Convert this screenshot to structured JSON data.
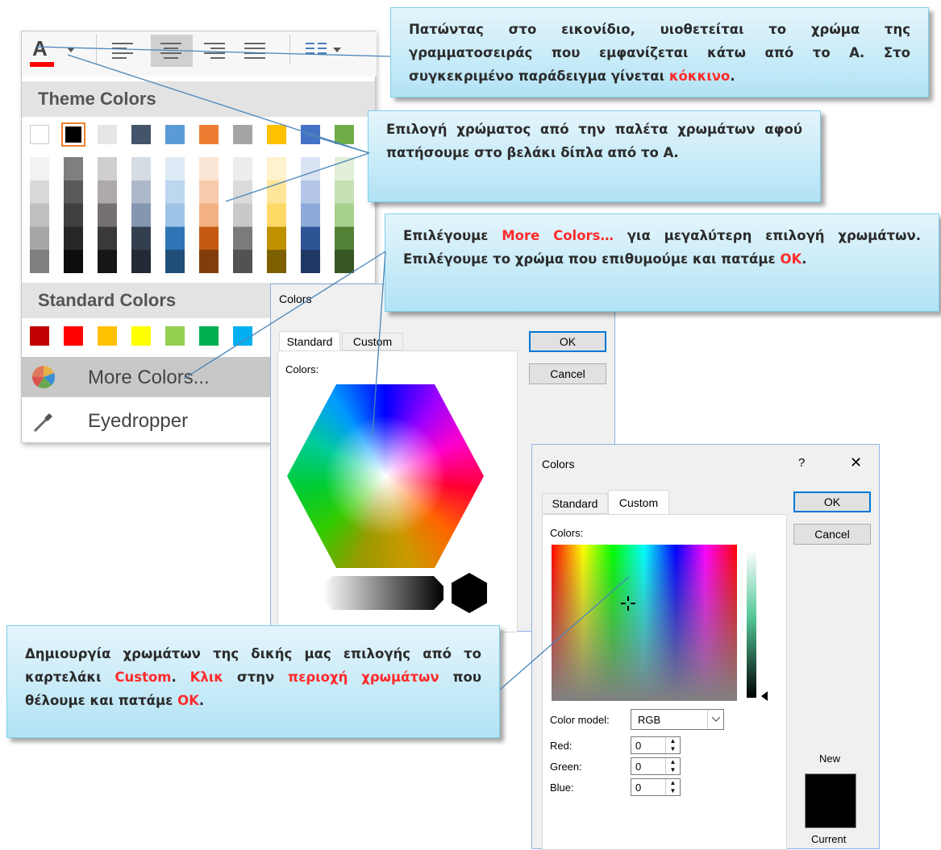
{
  "font_color_menu": {
    "theme_colors_label": "Theme Colors",
    "standard_colors_label": "Standard Colors",
    "more_colors_label": "More Colors...",
    "eyedropper_label": "Eyedropper",
    "theme_top_row": [
      "#ffffff",
      "#000000",
      "#e7e6e6",
      "#44546a",
      "#5b9bd5",
      "#ed7d31",
      "#a5a5a5",
      "#ffc000",
      "#4472c4",
      "#70ad47"
    ],
    "standard_colors": [
      "#c00000",
      "#ff0000",
      "#ffc000",
      "#ffff00",
      "#92d050",
      "#00b050",
      "#00b0f0"
    ],
    "current_font_color": "#ff0000"
  },
  "dialog_standard": {
    "title": "Colors",
    "tab_standard": "Standard",
    "tab_custom": "Custom",
    "colors_label": "Colors:",
    "ok_label": "OK",
    "cancel_label": "Cancel"
  },
  "dialog_custom": {
    "title": "Colors",
    "help_icon": "?",
    "close_icon": "✕",
    "tab_standard": "Standard",
    "tab_custom": "Custom",
    "colors_label": "Colors:",
    "ok_label": "OK",
    "cancel_label": "Cancel",
    "color_model_label": "Color model:",
    "color_model_value": "RGB",
    "red_label": "Red:",
    "red_value": "0",
    "green_label": "Green:",
    "green_value": "0",
    "blue_label": "Blue:",
    "blue_value": "0",
    "new_label": "New",
    "current_label": "Current"
  },
  "callouts": {
    "c1": {
      "text": "Πατώντας στο εικονίδιο, υιοθετείται το χρώμα της γραμματοσειράς που εμφανίζεται κάτω από το Α. Στο συγκεκριμένο παράδειγμα γίνεται ",
      "red": "κόκκινο",
      "tail": "."
    },
    "c2": {
      "text": "Επιλογή χρώματος από την παλέτα χρωμάτων αφού πατήσουμε στο βελάκι δίπλα από το Α."
    },
    "c3": {
      "a": "Επιλέγουμε ",
      "red1": "More Colors…",
      "b": " για μεγαλύτερη επιλογή χρωμάτων. Επιλέγουμε το χρώμα που επιθυμούμε και πατάμε ",
      "red2": "OK",
      "c": "."
    },
    "c4": {
      "a": "Δημιουργία χρωμάτων της δικής μας επιλογής από το καρτελάκι ",
      "red1": "Custom",
      "b": ". ",
      "red2": "Κλικ",
      "c": " στην ",
      "red3": "περιοχή χρωμάτων",
      "d": " που θέλουμε και πατάμε ",
      "red4": "OK",
      "e": "."
    }
  }
}
